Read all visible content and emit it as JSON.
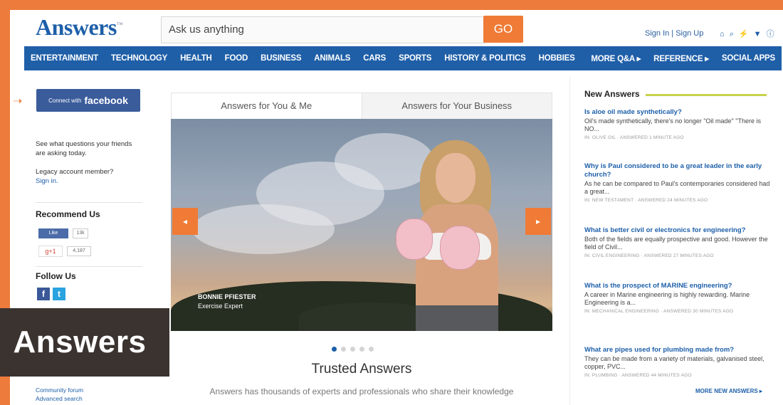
{
  "header": {
    "logo_text": "Answers",
    "logo_tm": "™",
    "search_placeholder": "Ask us anything",
    "go_label": "GO",
    "signin_text": "Sign In | Sign Up",
    "icons_text": "⌂ ⌕ ⚡ ▼ ⓘ"
  },
  "nav": {
    "items": [
      "ENTERTAINMENT",
      "TECHNOLOGY",
      "HEALTH",
      "FOOD",
      "BUSINESS",
      "ANIMALS",
      "CARS",
      "SPORTS",
      "HISTORY & POLITICS",
      "HOBBIES"
    ],
    "right_items": [
      "MORE Q&A ▸",
      "REFERENCE ▸",
      "SOCIAL APPS"
    ]
  },
  "left": {
    "fb_small": "Connect with",
    "fb_big": "facebook",
    "see_text": "See what questions your friends are asking today.",
    "legacy_text": "Legacy account member?",
    "legacy_link": "Sign in.",
    "recommend_head": "Recommend Us",
    "like_label": "Like",
    "like_count": "13k",
    "gplus_label": "g+1",
    "gplus_count": "4,187",
    "follow_head": "Follow Us",
    "fb_icon": "f",
    "tw_icon": "t",
    "community_link": "Community forum",
    "advanced_link": "Advanced search"
  },
  "watermark": "Answers",
  "center": {
    "tab1": "Answers for You & Me",
    "tab2": "Answers for Your Business",
    "caption_name": "BONNIE PFIESTER",
    "caption_role": "Exercise Expert",
    "prev_arrow": "◂",
    "next_arrow": "▸",
    "trusted_title": "Trusted Answers",
    "trusted_desc": "Answers has thousands of experts and professionals who share their knowledge"
  },
  "right": {
    "head": "New Answers",
    "questions": [
      {
        "q": "Is aloe oil made synthetically?",
        "a": "Oil's made synthetically, there's no longer \"Oil made\" \"There is NO...",
        "m": "IN: OLIVE OIL · ANSWERED 1 MINUTE AGO"
      },
      {
        "q": "Why is Paul considered to be a great leader in the early church?",
        "a": "As he can be compared to Paul's contemporaries considered had a great...",
        "m": "IN: NEW TESTAMENT · ANSWERED 24 MINUTES AGO"
      },
      {
        "q": "What is better civil or electronics for engineering?",
        "a": "Both of the fields are equally prospective and good. However the field of Civil...",
        "m": "IN: CIVIL ENGINEERING · ANSWERED 27 MINUTES AGO"
      },
      {
        "q": "What is the prospect of MARINE engineering?",
        "a": "A career in Marine engineering is highly rewarding. Marine Engineering is a...",
        "m": "IN: MECHANICAL ENGINEERING · ANSWERED 30 MINUTES AGO"
      },
      {
        "q": "What are pipes used for plumbing made from?",
        "a": "They can be made from a variety of materials, galvanised steel, copper, PVC...",
        "m": "IN: PLUMBING · ANSWERED 44 MINUTES AGO"
      }
    ],
    "more_link": "MORE NEW ANSWERS ▸"
  }
}
